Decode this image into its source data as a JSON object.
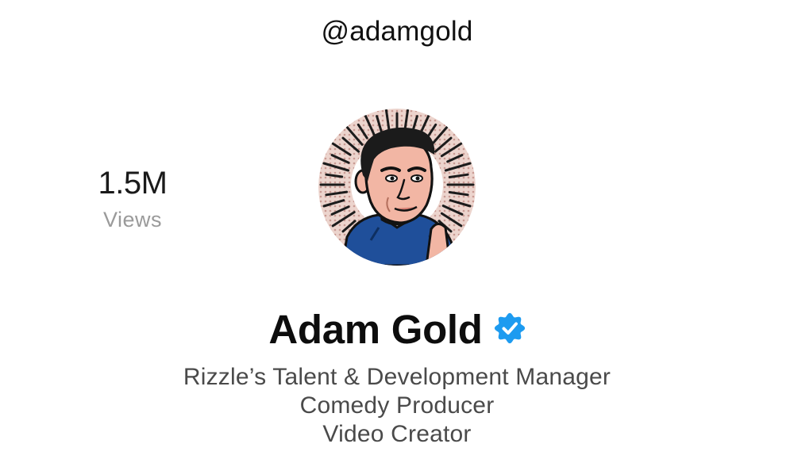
{
  "profile": {
    "username": "@adamgold",
    "display_name": "Adam Gold",
    "verified_icon": "verified-badge-icon",
    "avatar_icon": "cartoon-portrait-avatar",
    "bio_lines": [
      "Rizzle’s Talent & Development Manager",
      "Comedy Producer",
      "Video Creator"
    ]
  },
  "stats": {
    "views_value": "1.5M",
    "views_label": "Views"
  },
  "colors": {
    "verified_blue": "#1d9bf0",
    "username_text": "#111111",
    "stat_label": "#9a9a9a",
    "bio_text": "#4a4a4a",
    "avatar_background": "#e8c9c0",
    "shirt_blue": "#1f4f9a"
  }
}
